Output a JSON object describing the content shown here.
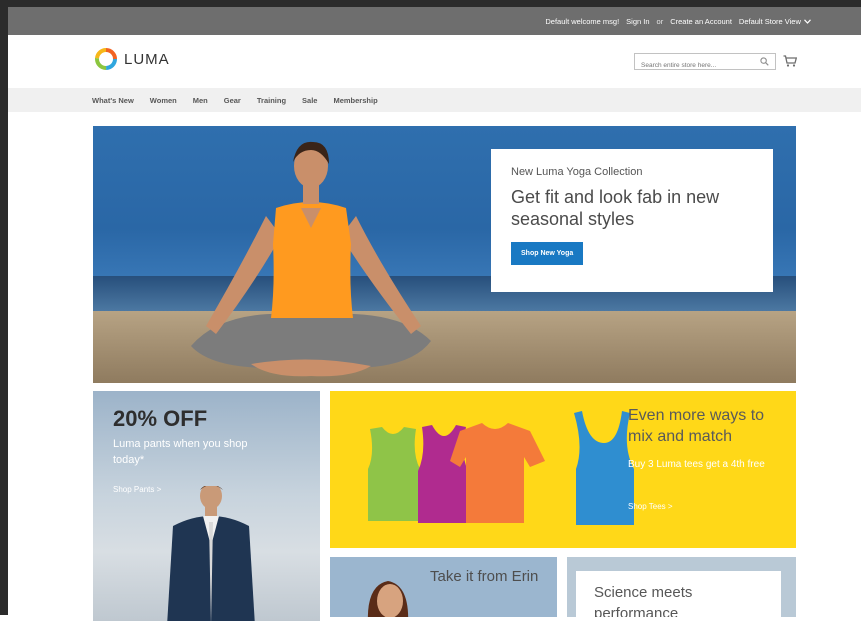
{
  "top_links": {
    "welcome": "Default welcome msg!",
    "sign_in": "Sign In",
    "or": "or",
    "create_account": "Create an Account",
    "store_view": "Default Store View"
  },
  "header": {
    "logo_text": "LUMA",
    "search_placeholder": "Search entire store here..."
  },
  "nav": {
    "items": [
      "What's New",
      "Women",
      "Men",
      "Gear",
      "Training",
      "Sale",
      "Membership"
    ]
  },
  "hero": {
    "kicker": "New Luma Yoga Collection",
    "title": "Get fit and look fab in new seasonal styles",
    "button": "Shop New Yoga"
  },
  "promo_pants": {
    "headline": "20% OFF",
    "subtext": "Luma pants when you shop today*",
    "link": "Shop Pants >"
  },
  "promo_tees": {
    "headline": "Even more ways to mix and match",
    "subtext": "Buy 3 Luma tees get a 4th free",
    "link": "Shop Tees >"
  },
  "promo_erin": {
    "text": "Take it from Erin"
  },
  "promo_science": {
    "text": "Science meets performance"
  },
  "icons": {
    "logo": "luma-logo-icon",
    "search": "search-icon",
    "cart": "cart-icon",
    "dropdown": "chevron-down-icon"
  },
  "colors": {
    "topbar": "#6e6e6e",
    "primary_button": "#1979c3",
    "tees_banner": "#ffd818"
  }
}
